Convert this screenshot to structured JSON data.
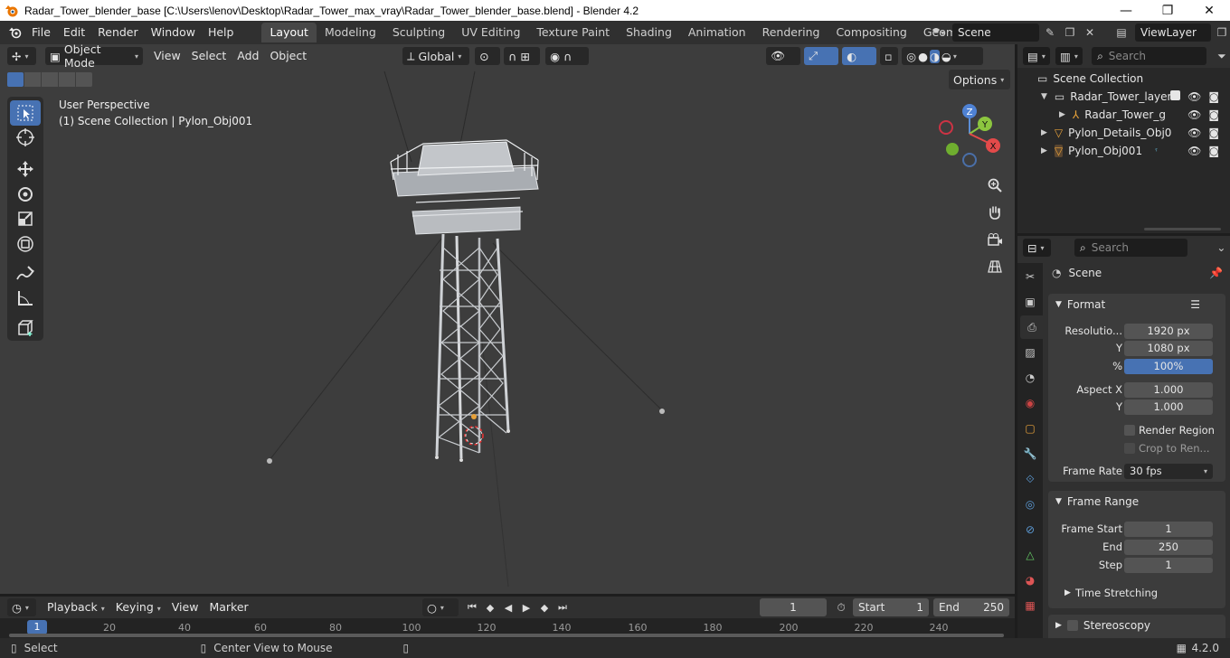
{
  "window": {
    "title": "Radar_Tower_blender_base [C:\\Users\\lenov\\Desktop\\Radar_Tower_max_vray\\Radar_Tower_blender_base.blend] - Blender 4.2",
    "minimize": "—",
    "maximize": "❐",
    "close": "✕"
  },
  "menu": [
    "File",
    "Edit",
    "Render",
    "Window",
    "Help"
  ],
  "workspaces": [
    {
      "label": "Layout",
      "active": true
    },
    {
      "label": "Modeling"
    },
    {
      "label": "Sculpting"
    },
    {
      "label": "UV Editing"
    },
    {
      "label": "Texture Paint"
    },
    {
      "label": "Shading"
    },
    {
      "label": "Animation"
    },
    {
      "label": "Rendering"
    },
    {
      "label": "Compositing"
    },
    {
      "label": "Geometry Nod"
    }
  ],
  "scene_selector": {
    "value": "Scene"
  },
  "viewlayer_selector": {
    "value": "ViewLayer"
  },
  "viewport": {
    "mode": "Object Mode",
    "menus": [
      "View",
      "Select",
      "Add",
      "Object"
    ],
    "transform_orientation": "Global",
    "options_label": "Options",
    "overlay_title": "User Perspective",
    "overlay_subtitle": "(1) Scene Collection | Pylon_Obj001",
    "gizmo": {
      "z": "Z",
      "y": "Y",
      "x": "X"
    }
  },
  "outliner": {
    "search_placeholder": "Search",
    "root": "Scene Collection",
    "items": [
      {
        "label": "Radar_Tower_layer",
        "level": 1,
        "expanded": true
      },
      {
        "label": "Radar_Tower_g",
        "level": 2
      },
      {
        "label": "Pylon_Details_Obj0",
        "level": 1
      },
      {
        "label": "Pylon_Obj001",
        "level": 1,
        "selected": true
      }
    ]
  },
  "properties": {
    "search_placeholder": "Search",
    "context": "Scene",
    "format_panel": {
      "title": "Format",
      "resolution_label": "Resolutio...",
      "resolution_x": "1920 px",
      "y_label": "Y",
      "resolution_y": "1080 px",
      "pct_label": "%",
      "percent": "100%",
      "aspect_x_label": "Aspect X",
      "aspect_x": "1.000",
      "aspect_y_label": "Y",
      "aspect_y": "1.000",
      "render_region": "Render Region",
      "crop": "Crop to Ren...",
      "frame_rate_label": "Frame Rate",
      "frame_rate": "30 fps"
    },
    "frame_range_panel": {
      "title": "Frame Range",
      "start_label": "Frame Start",
      "start": "1",
      "end_label": "End",
      "end": "250",
      "step_label": "Step",
      "step": "1",
      "time_stretching": "Time Stretching"
    },
    "stereoscopy_label": "Stereoscopy"
  },
  "timeline": {
    "menus": [
      "Playback",
      "Keying",
      "View",
      "Marker"
    ],
    "current_frame": "1",
    "start_label": "Start",
    "start": "1",
    "end_label": "End",
    "end": "250",
    "ticks": [
      "1",
      "20",
      "40",
      "60",
      "80",
      "100",
      "120",
      "140",
      "160",
      "180",
      "200",
      "220",
      "240"
    ]
  },
  "status": {
    "select": "Select",
    "center_view": "Center View to Mouse",
    "version": "4.2.0"
  },
  "colors": {
    "accent": "#4772b3",
    "viewport_bg": "#3d3d3d",
    "selected_outline": "#e8a23a"
  }
}
